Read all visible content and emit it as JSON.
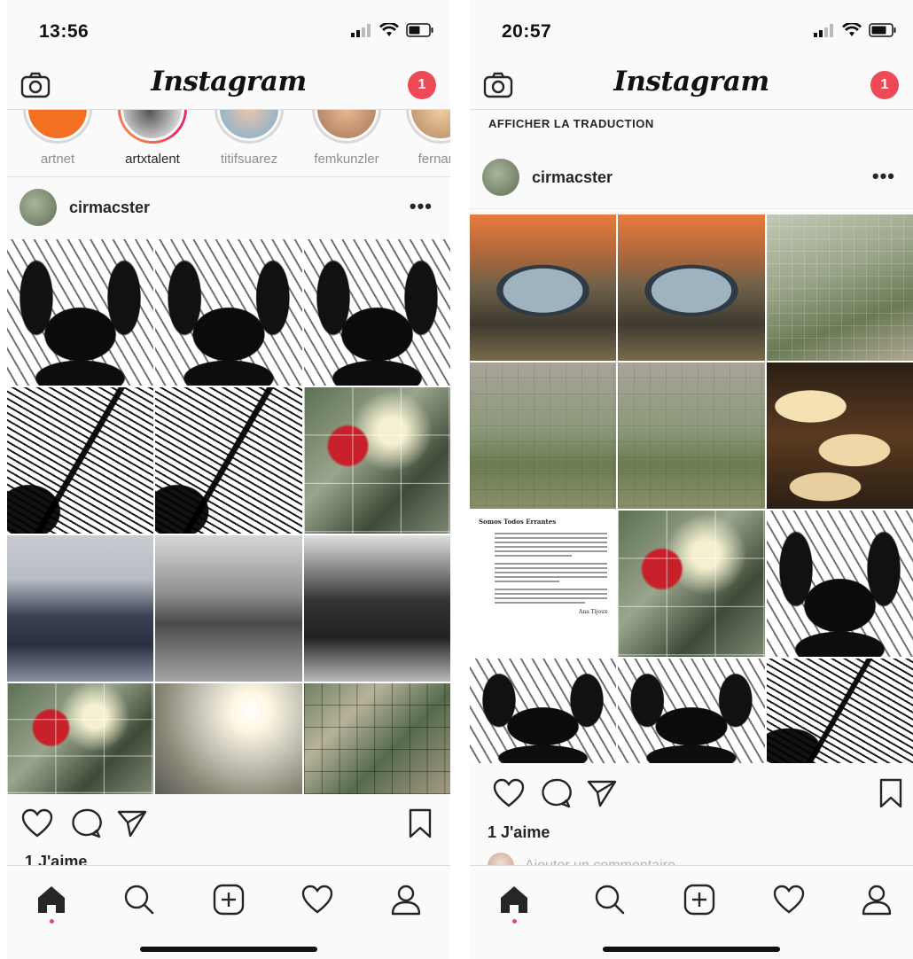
{
  "left": {
    "status": {
      "time": "13:56"
    },
    "header": {
      "logo": "Instagram",
      "badge_count": "1"
    },
    "stories": [
      {
        "name": "artnet",
        "seen": true
      },
      {
        "name": "artxtalent",
        "seen": false
      },
      {
        "name": "titifsuarez",
        "seen": true
      },
      {
        "name": "femkunzler",
        "seen": true
      },
      {
        "name": "fernand",
        "seen": true
      }
    ],
    "post": {
      "username": "cirmacster",
      "likes": "1 J'aime"
    }
  },
  "right": {
    "status": {
      "time": "20:57"
    },
    "header": {
      "logo": "Instagram",
      "badge_count": "1"
    },
    "translate_label": "AFFICHER LA TRADUCTION",
    "post": {
      "username": "cirmacster",
      "likes": "1 J'aime",
      "comment_placeholder": "Ajouter un commentaire…"
    },
    "doc": {
      "title": "Somos Todos Errantes",
      "signature": "Ana Tijoux"
    }
  },
  "icons": {
    "camera": "camera-icon",
    "heart": "heart-icon",
    "comment": "comment-icon",
    "share": "send-icon",
    "bookmark": "bookmark-icon",
    "home": "home-icon",
    "search": "search-icon",
    "add": "add-post-icon",
    "activity": "heart-icon",
    "profile": "profile-icon",
    "more": "more-icon"
  },
  "colors": {
    "notification": "#ed4956",
    "text": "#262626",
    "secondary": "#8e8e8e"
  }
}
